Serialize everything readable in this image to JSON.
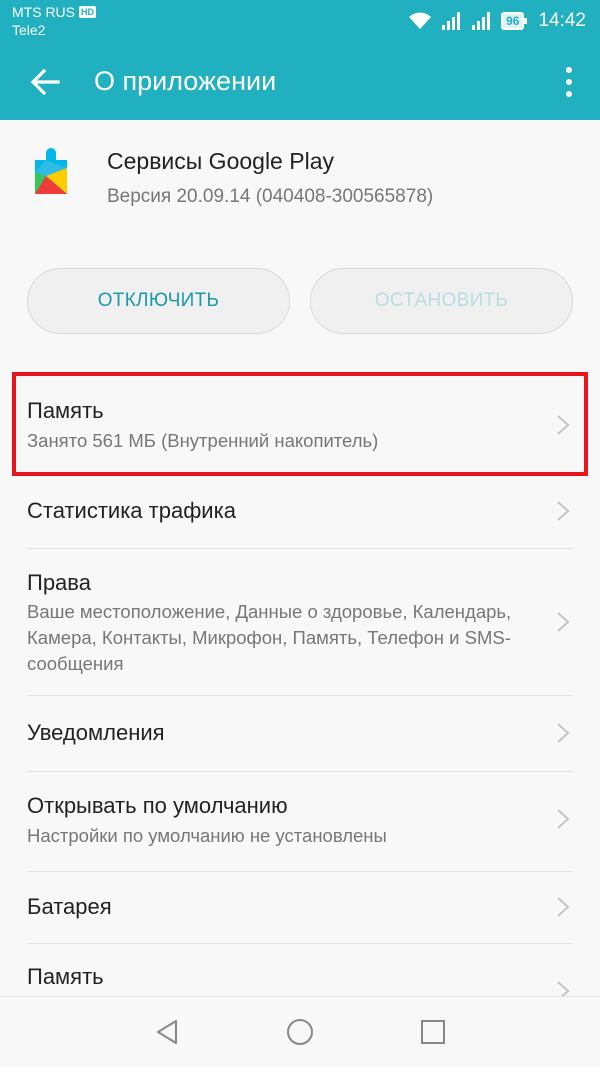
{
  "status_bar": {
    "carrier_primary": "MTS RUS",
    "hd_badge": "HD",
    "carrier_secondary": "Tele2",
    "battery": "96",
    "time": "14:42",
    "icons": [
      "wifi-icon",
      "signal-icon",
      "signal-icon",
      "battery-icon"
    ]
  },
  "app_bar": {
    "title": "О приложении",
    "back_icon": "arrow-left-icon",
    "menu_icon": "more-vertical-icon"
  },
  "app": {
    "name": "Сервисы Google Play",
    "version": "Версия 20.09.14 (040408-300565878)",
    "icon": "google-play-services-icon"
  },
  "actions": {
    "disable_label": "ОТКЛЮЧИТЬ",
    "stop_label": "ОСТАНОВИТЬ"
  },
  "settings": [
    {
      "title": "Память",
      "subtitle": "Занято 561 МБ (Внутренний накопитель)"
    },
    {
      "title": "Статистика трафика"
    },
    {
      "title": "Права",
      "subtitle": "Ваше местоположение, Данные о здоровье, Календарь, Камера, Контакты, Микрофон, Память, Телефон и SMS-сообщения"
    },
    {
      "title": "Уведомления"
    },
    {
      "title": "Открывать по умолчанию",
      "subtitle": "Настройки по умолчанию не установлены"
    },
    {
      "title": "Батарея"
    },
    {
      "title": "Память"
    }
  ],
  "colors": {
    "accent": "#21b0c0",
    "highlight": "#e8141e"
  },
  "nav_bar": [
    "back-triangle-icon",
    "home-circle-icon",
    "recents-square-icon"
  ]
}
